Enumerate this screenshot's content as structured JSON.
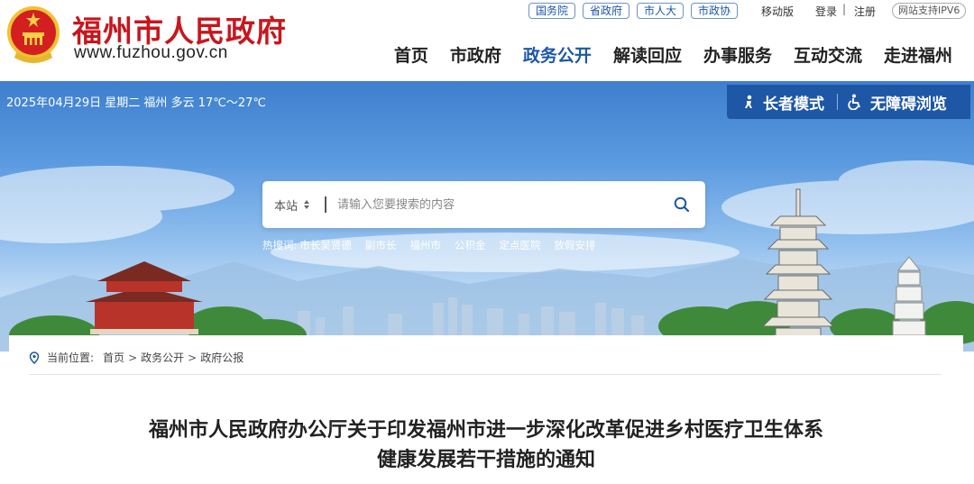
{
  "header": {
    "site_name": "福州市人民政府",
    "site_url": "www.fuzhou.gov.cn",
    "top_links": [
      "国务院",
      "省政府",
      "市人大",
      "市政协"
    ],
    "mobile": "移动版",
    "login": "登录",
    "separator": "|",
    "register": "注册",
    "ipv6": "网站支持IPV6",
    "nav": [
      "首页",
      "市政府",
      "政务公开",
      "解读回应",
      "办事服务",
      "互动交流",
      "走进福州"
    ],
    "active_nav": "政务公开"
  },
  "banner": {
    "weather": "2025年04月29日 星期二   福州 多云 17℃～27℃",
    "elder_mode": "长者模式",
    "accessibility": "无障碍浏览",
    "search": {
      "scope": "本站",
      "placeholder": "请输入您要搜索的内容"
    },
    "hot_label": "热搜词:",
    "hot_words": [
      "市长吴贤德",
      "副市长",
      "福州市",
      "公积金",
      "定点医院",
      "放假安排"
    ]
  },
  "content": {
    "location_label": "当前位置:",
    "breadcrumb": [
      "首页",
      "政务公开",
      "政府公报"
    ],
    "crumb_sep": ">",
    "title_line1": "福州市人民政府办公厅关于印发福州市进一步深化改革促进乡村医疗卫生体系",
    "title_line2": "健康发展若干措施的通知"
  },
  "colors": {
    "brand_red": "#c8161d",
    "brand_blue": "#1d57a6"
  },
  "icons": [
    "national-emblem-icon",
    "elder-mode-icon",
    "wheelchair-icon",
    "search-icon",
    "location-pin-icon",
    "sort-arrows-icon"
  ]
}
